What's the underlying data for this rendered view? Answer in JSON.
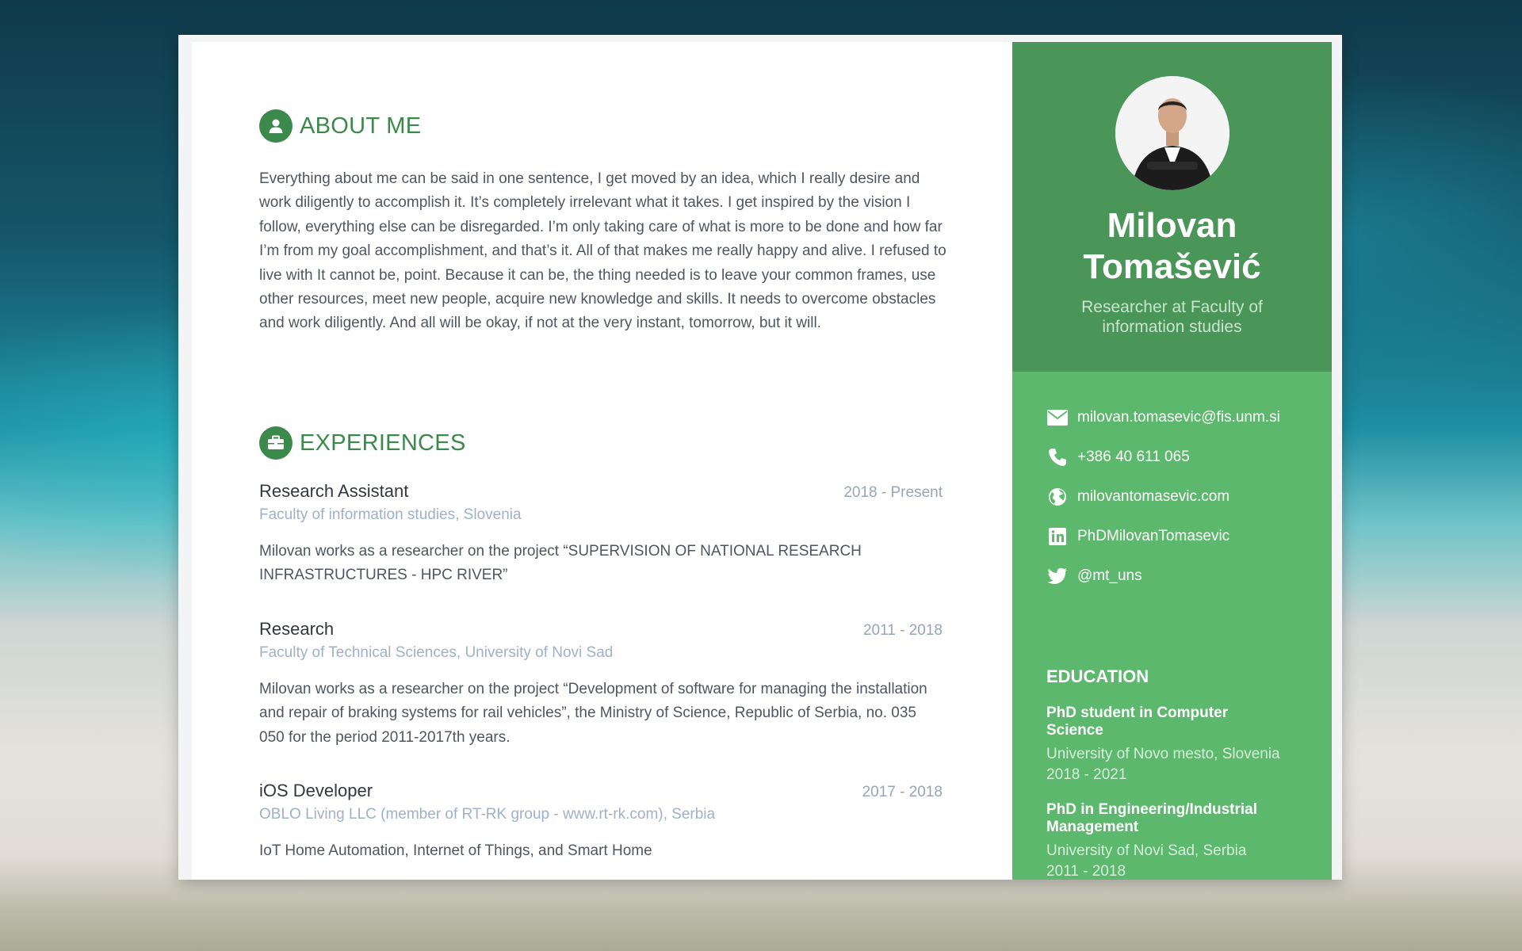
{
  "about": {
    "heading": "ABOUT ME",
    "text": "Everything about me can be said in one sentence, I get moved by an idea, which I really desire and work diligently to accomplish it. It’s completely irrelevant what it takes. I get inspired by the vision I follow, everything else can be disregarded. I’m only taking care of what is more to be done and how far I’m from my goal accomplishment, and that’s it. All of that makes me really happy and alive. I refused to live with It cannot be, point. Because it can be, the thing needed is to leave your common frames, use other resources, meet new people, acquire new knowledge and skills. It needs to overcome obstacles and work diligently. And all will be okay, if not at the very instant, tomorrow, but it will."
  },
  "experiences": {
    "heading": "EXPERIENCES",
    "items": [
      {
        "title": "Research Assistant",
        "date": "2018 - Present",
        "org": "Faculty of information studies, Slovenia",
        "desc": "Milovan works as a researcher on the project “SUPERVISION OF NATIONAL RESEARCH INFRASTRUCTURES - HPC RIVER”"
      },
      {
        "title": "Research",
        "date": "2011 - 2018",
        "org": "Faculty of Technical Sciences, University of Novi Sad",
        "desc": "Milovan works as a researcher on the project “Development of software for managing the installation and repair of braking systems for rail vehicles”, the Ministry of Science, Republic of Serbia, no. 035 050 for the period 2011-2017th years."
      },
      {
        "title": "iOS Developer",
        "date": "2017 - 2018",
        "org": "OBLO Living LLC (member of RT-RK group - www.rt-rk.com), Serbia",
        "desc": "IoT Home Automation, Internet of Things, and Smart Home"
      }
    ]
  },
  "profile": {
    "name_line1": "Milovan",
    "name_line2": "Tomašević",
    "title_line1": "Researcher at Faculty of",
    "title_line2": "information studies"
  },
  "contacts": {
    "email": "milovan.tomasevic@fis.unm.si",
    "phone": "+386 40 611 065",
    "website": "milovantomasevic.com",
    "linkedin": "PhDMilovanTomasevic",
    "twitter": "@mt_uns"
  },
  "education": {
    "heading": "EDUCATION",
    "items": [
      {
        "degree_line1": "PhD student in Computer",
        "degree_line2": "Science",
        "school": "University of Novo mesto, Slovenia",
        "years": "2018 - 2021"
      },
      {
        "degree_line1": "PhD in Engineering/Industrial",
        "degree_line2": "Management",
        "school": "University of Novi Sad, Serbia",
        "years": "2011 - 2018"
      }
    ]
  },
  "colors": {
    "accent": "#3b8a4c",
    "side_dark": "#4a9658",
    "side_light": "#5cb86c"
  }
}
